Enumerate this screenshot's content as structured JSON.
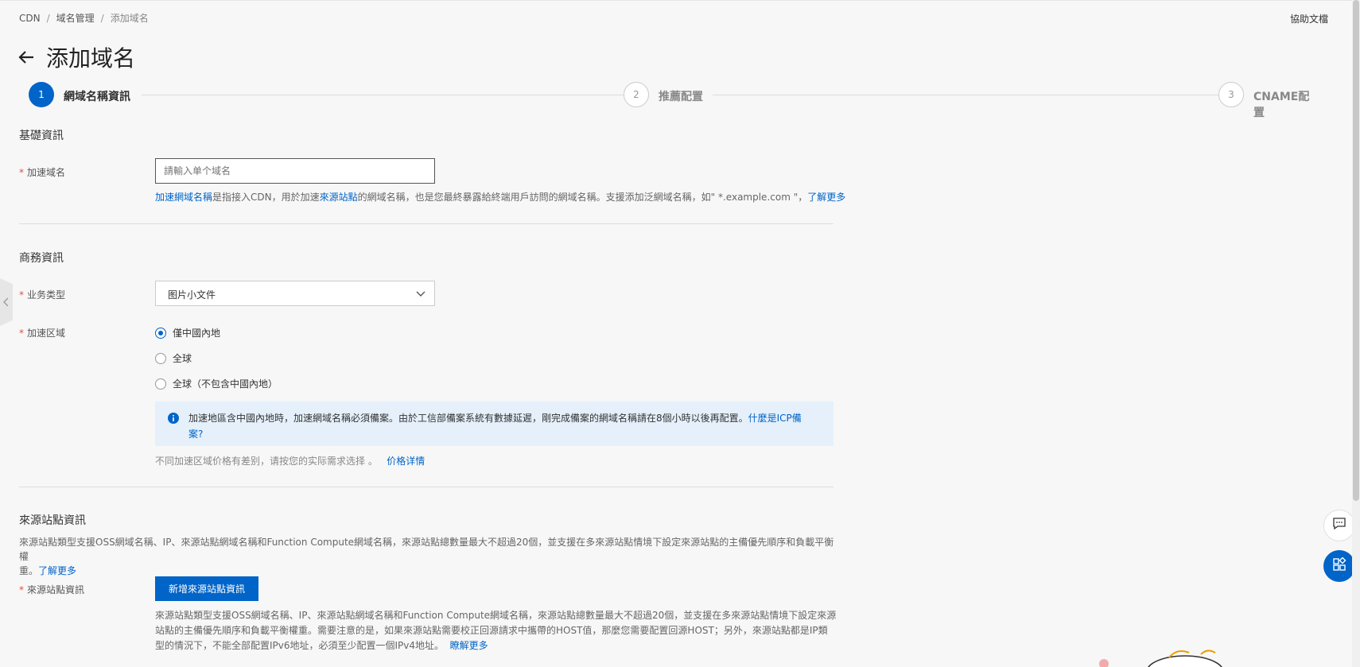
{
  "breadcrumb": {
    "items": [
      "CDN",
      "域名管理",
      "添加域名"
    ],
    "separator": "/"
  },
  "header": {
    "help_doc": "協助文檔",
    "title": "添加域名"
  },
  "steps": [
    {
      "number": "1",
      "label": "網域名稱資訊",
      "state": "active"
    },
    {
      "number": "2",
      "label": "推薦配置",
      "state": "todo"
    },
    {
      "number": "3",
      "label": "CNAME配置",
      "state": "todo"
    }
  ],
  "basic": {
    "section_title": "基礎資訊",
    "domain_label": "加速域名",
    "domain_placeholder": "請輸入单个域名",
    "domain_value": "",
    "help": {
      "link1": "加速網域名稱",
      "text1": "是指接入CDN，用於加速",
      "link2": "來源站點",
      "text2": "的網域名稱，也是您最終暴露給終端用戶訪問的網域名稱。支援添加泛網域名稱，如\" *.example.com \"，",
      "link3": "了解更多"
    }
  },
  "business": {
    "section_title": "商務資訊",
    "type_label": "业务类型",
    "type_value": "图片小文件",
    "region_label": "加速区域",
    "region_options": [
      "僅中國內地",
      "全球",
      "全球（不包含中國內地）"
    ],
    "region_selected": 0,
    "notice_text": "加速地區含中國內地時，加速網域名稱必須備案。由於工信部備案系統有數據延遲，剛完成備案的網域名稱請在8個小時以後再配置。",
    "notice_link_a": "什麼是ICP備",
    "notice_link_b": "案?",
    "price_note": "不同加速区域价格有差别，请按您的实际需求选择 。",
    "price_link": "价格详情"
  },
  "origin": {
    "section_title": "來源站點資訊",
    "desc_line1": "來源站點類型支援OSS網域名稱、IP、來源站點網域名稱和Function Compute網域名稱，來源站點總數量最大不超過20個，並支援在多來源站點情境下設定來源站點的主備優先順序和負載平衡權",
    "desc_line2": "重。",
    "desc_link": "了解更多",
    "field_label": "來源站點資訊",
    "add_button": "新增來源站點資訊",
    "help_line1": "來源站點類型支援OSS網域名稱、IP、來源站點網域名稱和Function Compute網域名稱，來源站點總數量最大不超過20個，並支援在多來源站點情境下設定來源",
    "help_line2": "站點的主備優先順序和負載平衡權重。需要注意的是，如果來源站點需要校正回源請求中攜帶的HOST值，那麼您需要配置回源HOST；另外，來源站點都是IP類",
    "help_line3": "型的情況下，不能全部配置IPv6地址，必須至少配置一個IPv4地址。",
    "help_link": "瞭解更多"
  },
  "colors": {
    "accent": "#0064c8",
    "required": "#e84c3d",
    "notice_bg": "#e5f0fb"
  },
  "icons": {
    "back": "back-arrow-icon",
    "select": "chevron-down-icon",
    "notice": "info-icon",
    "sidebar": "chevron-left-icon",
    "chat": "chat-icon",
    "apps": "apps-icon"
  }
}
